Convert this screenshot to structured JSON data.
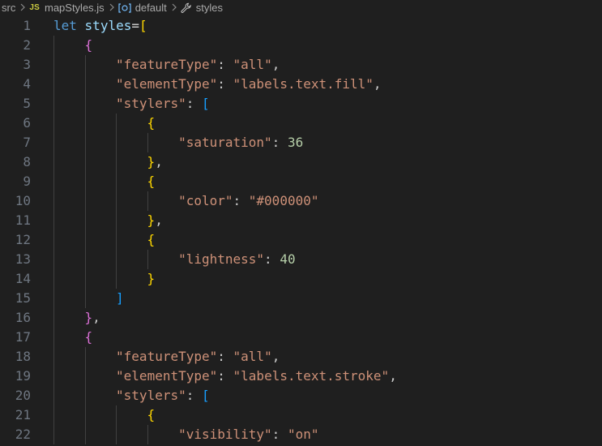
{
  "breadcrumb": {
    "folder": "src",
    "file_badge": "JS",
    "file": "mapStyles.js",
    "symbol": "default",
    "property": "styles"
  },
  "icons": {
    "separator": "chevron-right-icon",
    "symbol": "symbol-variable-icon",
    "property": "wrench-icon"
  },
  "colors": {
    "background": "#1f1f1f",
    "line_number": "#6e7681",
    "keyword": "#569cd6",
    "variable": "#9cdcfe",
    "string": "#ce9178",
    "number": "#b5cea8",
    "bracket_level_1": "#ffd700",
    "bracket_level_2": "#da70d6",
    "bracket_level_3": "#179fff"
  },
  "editor": {
    "lines": [
      {
        "n": "1",
        "indent": 0,
        "tokens": [
          [
            "kw",
            "let"
          ],
          [
            "punc",
            " "
          ],
          [
            "var",
            "styles"
          ],
          [
            "op",
            "="
          ],
          [
            "br1",
            "["
          ]
        ]
      },
      {
        "n": "2",
        "indent": 1,
        "tokens": [
          [
            "br2",
            "{"
          ]
        ]
      },
      {
        "n": "3",
        "indent": 2,
        "tokens": [
          [
            "str",
            "\"featureType\""
          ],
          [
            "punc",
            ": "
          ],
          [
            "str",
            "\"all\""
          ],
          [
            "punc",
            ","
          ]
        ]
      },
      {
        "n": "4",
        "indent": 2,
        "tokens": [
          [
            "str",
            "\"elementType\""
          ],
          [
            "punc",
            ": "
          ],
          [
            "str",
            "\"labels.text.fill\""
          ],
          [
            "punc",
            ","
          ]
        ]
      },
      {
        "n": "5",
        "indent": 2,
        "tokens": [
          [
            "str",
            "\"stylers\""
          ],
          [
            "punc",
            ": "
          ],
          [
            "br3",
            "["
          ]
        ]
      },
      {
        "n": "6",
        "indent": 3,
        "tokens": [
          [
            "br1",
            "{"
          ]
        ]
      },
      {
        "n": "7",
        "indent": 4,
        "tokens": [
          [
            "str",
            "\"saturation\""
          ],
          [
            "punc",
            ": "
          ],
          [
            "num",
            "36"
          ]
        ]
      },
      {
        "n": "8",
        "indent": 3,
        "tokens": [
          [
            "br1",
            "}"
          ],
          [
            "punc",
            ","
          ]
        ]
      },
      {
        "n": "9",
        "indent": 3,
        "tokens": [
          [
            "br1",
            "{"
          ]
        ]
      },
      {
        "n": "10",
        "indent": 4,
        "tokens": [
          [
            "str",
            "\"color\""
          ],
          [
            "punc",
            ": "
          ],
          [
            "str",
            "\"#000000\""
          ]
        ]
      },
      {
        "n": "11",
        "indent": 3,
        "tokens": [
          [
            "br1",
            "}"
          ],
          [
            "punc",
            ","
          ]
        ]
      },
      {
        "n": "12",
        "indent": 3,
        "tokens": [
          [
            "br1",
            "{"
          ]
        ]
      },
      {
        "n": "13",
        "indent": 4,
        "tokens": [
          [
            "str",
            "\"lightness\""
          ],
          [
            "punc",
            ": "
          ],
          [
            "num",
            "40"
          ]
        ]
      },
      {
        "n": "14",
        "indent": 3,
        "tokens": [
          [
            "br1",
            "}"
          ]
        ]
      },
      {
        "n": "15",
        "indent": 2,
        "tokens": [
          [
            "br3",
            "]"
          ]
        ]
      },
      {
        "n": "16",
        "indent": 1,
        "tokens": [
          [
            "br2",
            "}"
          ],
          [
            "punc",
            ","
          ]
        ]
      },
      {
        "n": "17",
        "indent": 1,
        "tokens": [
          [
            "br2",
            "{"
          ]
        ]
      },
      {
        "n": "18",
        "indent": 2,
        "tokens": [
          [
            "str",
            "\"featureType\""
          ],
          [
            "punc",
            ": "
          ],
          [
            "str",
            "\"all\""
          ],
          [
            "punc",
            ","
          ]
        ]
      },
      {
        "n": "19",
        "indent": 2,
        "tokens": [
          [
            "str",
            "\"elementType\""
          ],
          [
            "punc",
            ": "
          ],
          [
            "str",
            "\"labels.text.stroke\""
          ],
          [
            "punc",
            ","
          ]
        ]
      },
      {
        "n": "20",
        "indent": 2,
        "tokens": [
          [
            "str",
            "\"stylers\""
          ],
          [
            "punc",
            ": "
          ],
          [
            "br3",
            "["
          ]
        ]
      },
      {
        "n": "21",
        "indent": 3,
        "tokens": [
          [
            "br1",
            "{"
          ]
        ]
      },
      {
        "n": "22",
        "indent": 4,
        "tokens": [
          [
            "str",
            "\"visibility\""
          ],
          [
            "punc",
            ": "
          ],
          [
            "str",
            "\"on\""
          ]
        ]
      }
    ]
  }
}
